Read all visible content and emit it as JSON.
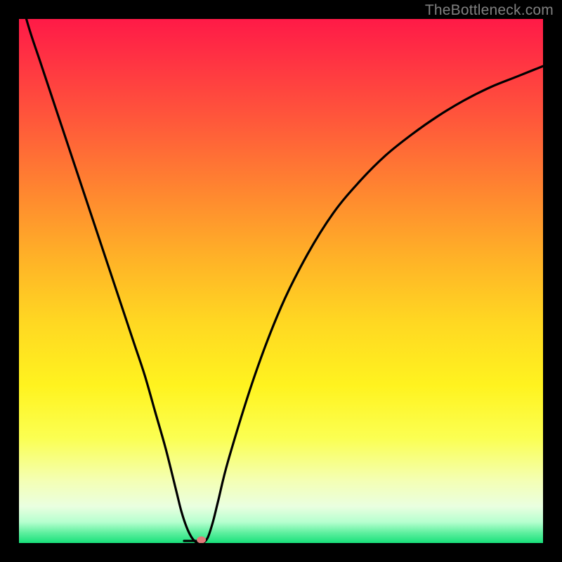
{
  "watermark": "TheBottleneck.com",
  "marker": {
    "color": "#e07a7a"
  },
  "chart_data": {
    "type": "line",
    "title": "",
    "xlabel": "",
    "ylabel": "",
    "xlim": [
      0,
      100
    ],
    "ylim": [
      0,
      100
    ],
    "series": [
      {
        "name": "curve",
        "x": [
          0,
          2,
          4,
          6,
          8,
          10,
          12,
          14,
          16,
          18,
          20,
          22,
          24,
          26,
          28,
          30,
          31,
          32,
          33,
          34,
          35,
          36,
          37,
          38,
          40,
          45,
          50,
          55,
          60,
          65,
          70,
          75,
          80,
          85,
          90,
          95,
          100
        ],
        "y": [
          105,
          98,
          92,
          86,
          80,
          74,
          68,
          62,
          56,
          50,
          44,
          38,
          32,
          25,
          18,
          10,
          6,
          3,
          1,
          0,
          0,
          1,
          4,
          8,
          16,
          32,
          45,
          55,
          63,
          69,
          74,
          78,
          81.5,
          84.5,
          87,
          89,
          91
        ]
      }
    ],
    "flat_segment": {
      "x0": 31.5,
      "x1": 34.5,
      "y": 0.4
    },
    "marker_point": {
      "x": 34.8,
      "y": 0.6
    }
  }
}
